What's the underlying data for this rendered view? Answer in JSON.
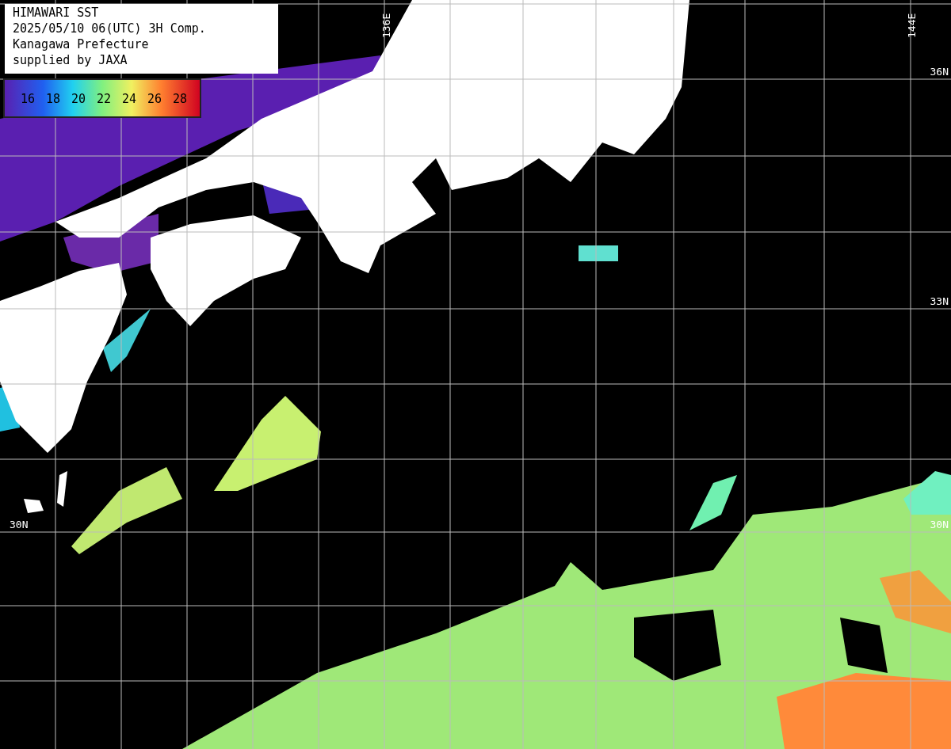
{
  "header": {
    "lines": [
      "HIMAWARI SST",
      "2025/05/10 06(UTC) 3H Comp.",
      "Kanagawa Prefecture",
      "supplied by JAXA"
    ]
  },
  "legend": {
    "labels": [
      "16",
      "18",
      "20",
      "22",
      "24",
      "26",
      "28"
    ]
  },
  "grid_labels": {
    "longitude": [
      "136E",
      "144E"
    ],
    "latitude_right": [
      "36N",
      "33N",
      "30N"
    ],
    "latitude_left": [
      "30N"
    ]
  }
}
